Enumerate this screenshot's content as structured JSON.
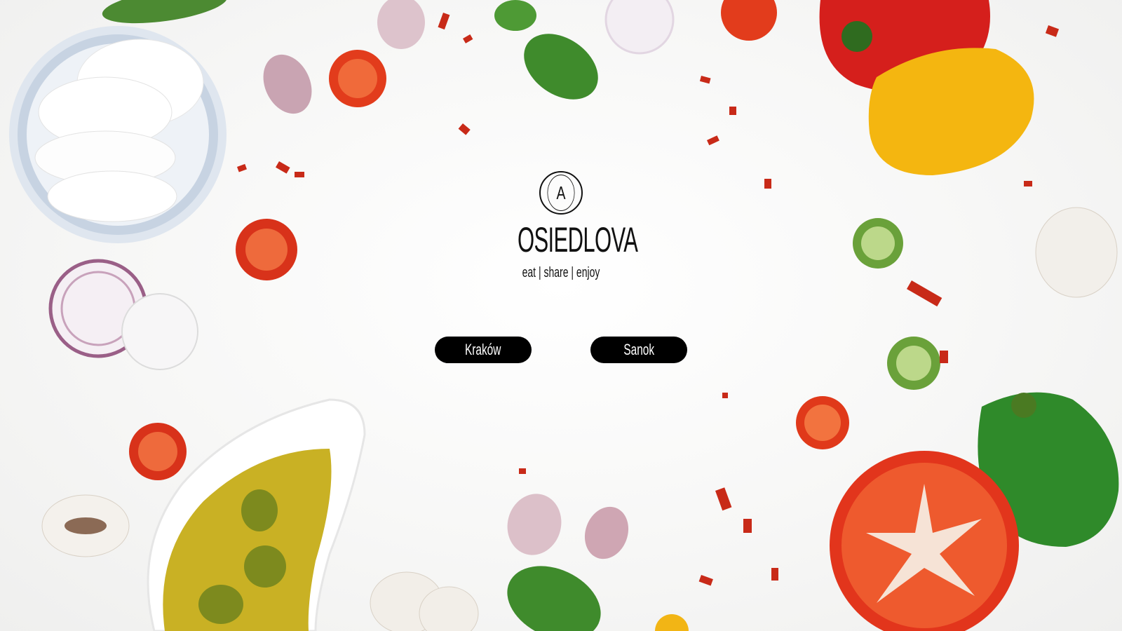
{
  "brand": {
    "emblem_letter": "A",
    "name": "OSIEDLOVA",
    "tagline": "eat | share | enjoy"
  },
  "locations": [
    {
      "label": "Kraków"
    },
    {
      "label": "Sanok"
    }
  ],
  "colors": {
    "background": "#f4f4f3",
    "button_bg": "#000000",
    "button_text": "#ffffff",
    "logo_text": "#111111"
  }
}
